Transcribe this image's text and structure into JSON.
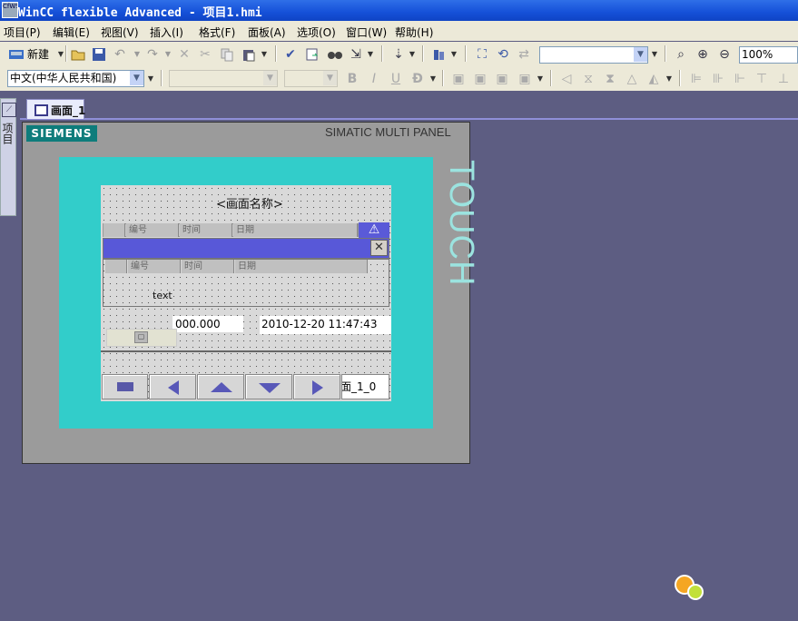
{
  "window": {
    "title": "WinCC flexible Advanced - 项目1.hmi",
    "icon_text": "CfWS"
  },
  "menu": {
    "items": [
      "项目(P)",
      "编辑(E)",
      "视图(V)",
      "插入(I)",
      "格式(F)",
      "面板(A)",
      "选项(O)",
      "窗口(W)",
      "帮助(H)"
    ]
  },
  "toolbar": {
    "new_label": "新建",
    "zoom": "100%",
    "language": "中文(中华人民共和国)"
  },
  "tabs": [
    {
      "label": "画面_1",
      "icon": "screen-icon"
    }
  ],
  "side_panel": {
    "label": "项目"
  },
  "device": {
    "brand": "SIEMENS",
    "model": "SIMATIC MULTI PANEL",
    "touch": "TOUCH"
  },
  "screen": {
    "title": "<画面名称>",
    "alarm_columns": [
      "编号",
      "时间",
      "日期"
    ],
    "alarm_columns_2": [
      "编号",
      "时间",
      "日期"
    ],
    "text_field": "text",
    "io_value": "000.000",
    "datetime": "2010-12-20 11:47:43",
    "nav_button_label": "画面_1_0"
  },
  "colors": {
    "workspace": "#5d5d82",
    "bezel": "#32cdca",
    "titlebar": "#1550d8",
    "alarm_bar": "#5858d8"
  }
}
